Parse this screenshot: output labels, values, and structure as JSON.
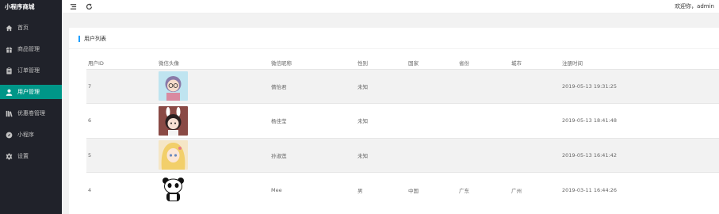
{
  "sidebar": {
    "brand": "小程序商城",
    "items": [
      {
        "label": "首页",
        "icon": "home-icon",
        "active": false
      },
      {
        "label": "商品管理",
        "icon": "gift-icon",
        "active": false
      },
      {
        "label": "订单管理",
        "icon": "clipboard-icon",
        "active": false
      },
      {
        "label": "用户管理",
        "icon": "user-icon",
        "active": true
      },
      {
        "label": "优惠卷管理",
        "icon": "books-icon",
        "active": false
      },
      {
        "label": "小程序",
        "icon": "compass-icon",
        "active": false
      },
      {
        "label": "设置",
        "icon": "gear-icon",
        "active": false
      }
    ]
  },
  "header": {
    "menu_icon": "menu-toggle-icon",
    "refresh_icon": "refresh-icon",
    "welcome": "欢迎你，admin"
  },
  "card": {
    "title": "用户列表",
    "accent_color": "#1e9fff"
  },
  "table": {
    "columns": [
      "用户ID",
      "微信头像",
      "微信昵称",
      "性别",
      "国家",
      "省份",
      "城市",
      "注册时间"
    ],
    "rows": [
      {
        "id": "7",
        "avatar": "avatar-girl-glasses",
        "nickname": "倩怡君",
        "gender": "未知",
        "country": "",
        "province": "",
        "city": "",
        "registered": "2019-05-13 19:31:25"
      },
      {
        "id": "6",
        "avatar": "avatar-bunny-girl",
        "nickname": "杨佳莹",
        "gender": "未知",
        "country": "",
        "province": "",
        "city": "",
        "registered": "2019-05-13 18:41:48"
      },
      {
        "id": "5",
        "avatar": "avatar-anime-blonde",
        "nickname": "孙淑莲",
        "gender": "未知",
        "country": "",
        "province": "",
        "city": "",
        "registered": "2019-05-13 16:41:42"
      },
      {
        "id": "4",
        "avatar": "avatar-panda",
        "nickname": "Mee",
        "gender": "男",
        "country": "中国",
        "province": "广东",
        "city": "广州",
        "registered": "2019-03-11 16:44:26"
      }
    ]
  },
  "colors": {
    "sidebar_bg": "#20222a",
    "active_bg": "#009688"
  }
}
